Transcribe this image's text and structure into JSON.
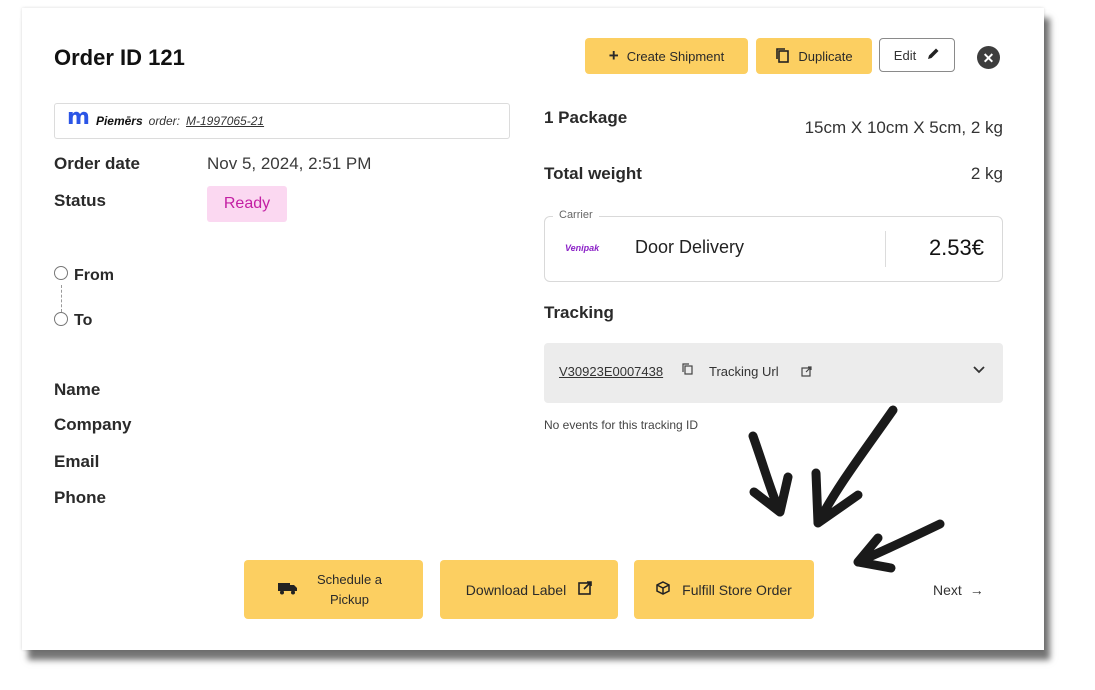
{
  "header": {
    "title": "Order ID 121",
    "create_shipment_label": "Create Shipment",
    "duplicate_label": "Duplicate",
    "edit_label": "Edit"
  },
  "merchant": {
    "logo_letter": "m",
    "brand": "Piemērs",
    "order_prefix": "order:",
    "order_number": "M-1997065-21"
  },
  "order_info": {
    "order_date_label": "Order date",
    "order_date_value": "Nov 5, 2024, 2:51 PM",
    "status_label": "Status",
    "status_value": "Ready"
  },
  "route": {
    "from_label": "From",
    "to_label": "To"
  },
  "contact": {
    "name_label": "Name",
    "company_label": "Company",
    "email_label": "Email",
    "phone_label": "Phone"
  },
  "package": {
    "count_label": "1 Package",
    "dimensions": "15cm X 10cm X 5cm, 2 kg",
    "total_weight_label": "Total weight",
    "total_weight_value": "2 kg"
  },
  "carrier": {
    "legend": "Carrier",
    "logo_text": "Venipak",
    "service": "Door Delivery",
    "price": "2.53€"
  },
  "tracking": {
    "heading": "Tracking",
    "tracking_id": "V30923E0007438",
    "tracking_url_label": "Tracking Url",
    "no_events": "No events for this tracking ID"
  },
  "footer": {
    "schedule_pickup_label": "Schedule a Pickup",
    "download_label": "Download Label",
    "fulfill_label": "Fulfill Store Order",
    "next_label": "Next",
    "next_arrow": "→"
  },
  "colors": {
    "accent_yellow": "#fccf61",
    "status_bg": "#fbd8f1",
    "status_text": "#c31fa3",
    "brand_blue": "#2b55e6",
    "carrier_purple": "#8b22c7"
  },
  "icons": [
    "plus-icon",
    "copy-icon",
    "pencil-icon",
    "close-icon",
    "copy-small-icon",
    "external-link-icon",
    "chevron-down-icon",
    "truck-icon",
    "box-icon",
    "arrow-right-icon"
  ]
}
